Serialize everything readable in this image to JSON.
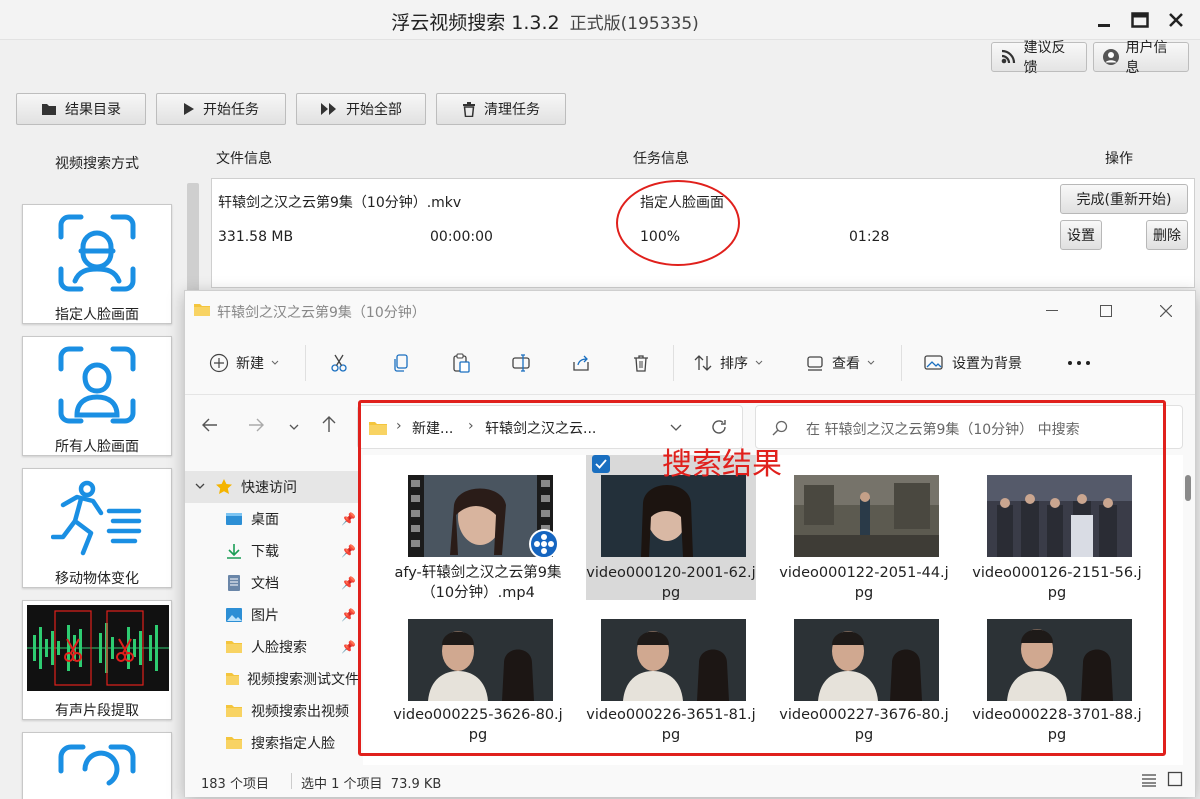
{
  "app": {
    "title": "浮云视频搜索 1.3.2",
    "version_tag": "正式版(195335)",
    "feedback_label": "建议反馈",
    "user_info_label": "用户信息"
  },
  "toolbar": {
    "results_dir": "结果目录",
    "start_task": "开始任务",
    "start_all": "开始全部",
    "clear_tasks": "清理任务"
  },
  "modes": {
    "title": "视频搜索方式",
    "items": [
      {
        "label": "指定人脸画面",
        "icon": "face-scan-icon"
      },
      {
        "label": "所有人脸画面",
        "icon": "person-scan-icon"
      },
      {
        "label": "移动物体变化",
        "icon": "running-person-icon"
      },
      {
        "label": "有声片段提取",
        "icon": "audio-cut-icon"
      }
    ]
  },
  "task_table": {
    "headers": {
      "file": "文件信息",
      "task": "任务信息",
      "ops": "操作"
    },
    "row": {
      "filename": "轩辕剑之汉之云第9集（10分钟）.mkv",
      "size": "331.58 MB",
      "start_time": "00:00:00",
      "mode": "指定人脸画面",
      "progress": "100%",
      "duration": "01:28",
      "done_button": "完成(重新开始)",
      "settings_button": "设置",
      "delete_button": "删除"
    }
  },
  "explorer": {
    "title": "轩辕剑之汉之云第9集（10分钟）",
    "commands": {
      "new": "新建",
      "sort": "排序",
      "view": "查看",
      "set_background": "设置为背景"
    },
    "breadcrumb": [
      "新建...",
      "轩辕剑之汉之云..."
    ],
    "search_placeholder": "在 轩辕剑之汉之云第9集（10分钟） 中搜索",
    "sidebar": {
      "quick_access": "快速访问",
      "items": [
        "桌面",
        "下载",
        "文档",
        "图片",
        "人脸搜索",
        "视频搜索测试文件",
        "视频搜索出视频",
        "搜索指定人脸"
      ]
    },
    "files": [
      "afy-轩辕剑之汉之云第9集（10分钟）.mp4",
      "video000120-2001-62.jpg",
      "video000122-2051-44.jpg",
      "video000126-2151-56.jpg",
      "video000225-3626-80.jpg",
      "video000226-3651-81.jpg",
      "video000227-3676-80.jpg",
      "video000228-3701-88.jpg"
    ],
    "status": {
      "count": "183 个项目",
      "selected": "选中 1 个项目  73.9 KB"
    }
  },
  "annotation": {
    "label": "搜索结果",
    "color": "#e0201c"
  },
  "colors": {
    "accent_blue": "#1a8fe3",
    "annotation_red": "#e0201c"
  }
}
